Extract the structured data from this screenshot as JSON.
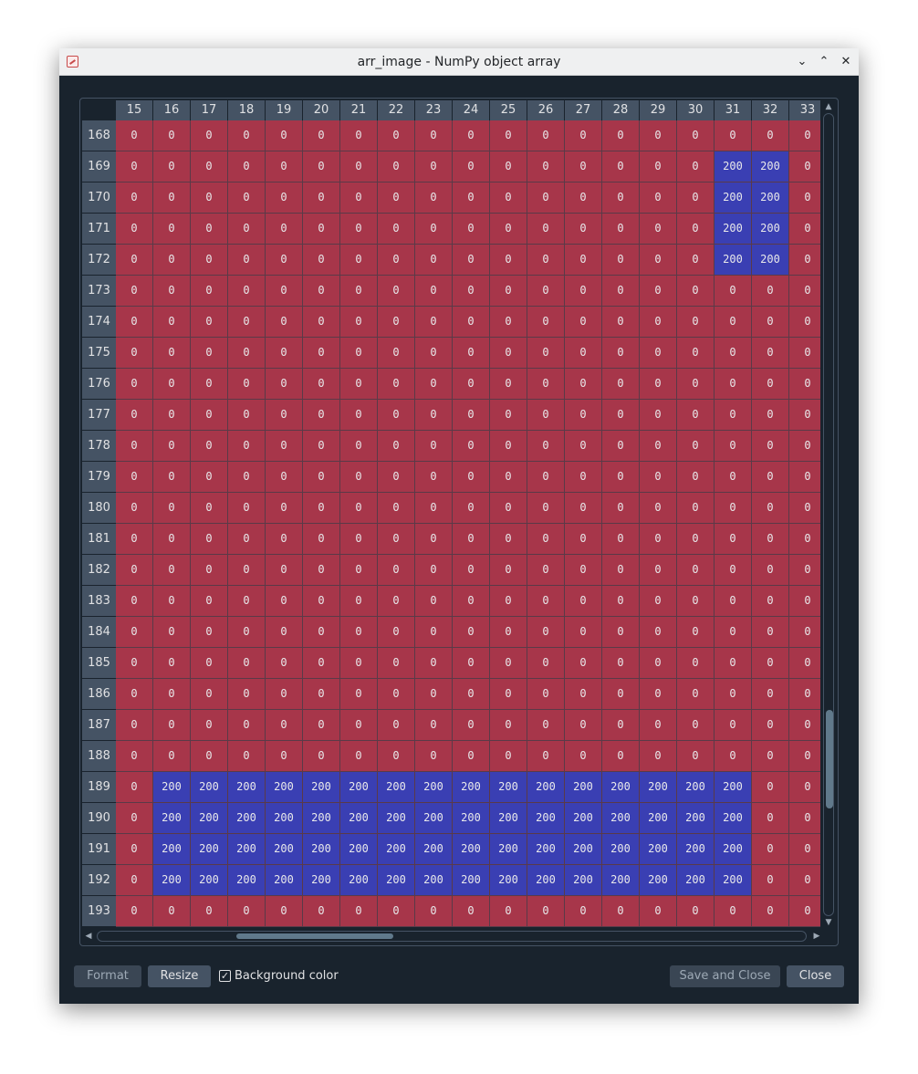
{
  "window": {
    "title": "arr_image - NumPy object array",
    "controls": {
      "minimize": "⌄",
      "maximize": "⌃",
      "close": "✕"
    }
  },
  "table": {
    "columns": [
      15,
      16,
      17,
      18,
      19,
      20,
      21,
      22,
      23,
      24,
      25,
      26,
      27,
      28,
      29,
      30,
      31,
      32,
      33
    ],
    "rows": [
      168,
      169,
      170,
      171,
      172,
      173,
      174,
      175,
      176,
      177,
      178,
      179,
      180,
      181,
      182,
      183,
      184,
      185,
      186,
      187,
      188,
      189,
      190,
      191,
      192,
      193
    ],
    "values": [
      [
        0,
        0,
        0,
        0,
        0,
        0,
        0,
        0,
        0,
        0,
        0,
        0,
        0,
        0,
        0,
        0,
        0,
        0,
        0
      ],
      [
        0,
        0,
        0,
        0,
        0,
        0,
        0,
        0,
        0,
        0,
        0,
        0,
        0,
        0,
        0,
        0,
        200,
        200,
        0
      ],
      [
        0,
        0,
        0,
        0,
        0,
        0,
        0,
        0,
        0,
        0,
        0,
        0,
        0,
        0,
        0,
        0,
        200,
        200,
        0
      ],
      [
        0,
        0,
        0,
        0,
        0,
        0,
        0,
        0,
        0,
        0,
        0,
        0,
        0,
        0,
        0,
        0,
        200,
        200,
        0
      ],
      [
        0,
        0,
        0,
        0,
        0,
        0,
        0,
        0,
        0,
        0,
        0,
        0,
        0,
        0,
        0,
        0,
        200,
        200,
        0
      ],
      [
        0,
        0,
        0,
        0,
        0,
        0,
        0,
        0,
        0,
        0,
        0,
        0,
        0,
        0,
        0,
        0,
        0,
        0,
        0
      ],
      [
        0,
        0,
        0,
        0,
        0,
        0,
        0,
        0,
        0,
        0,
        0,
        0,
        0,
        0,
        0,
        0,
        0,
        0,
        0
      ],
      [
        0,
        0,
        0,
        0,
        0,
        0,
        0,
        0,
        0,
        0,
        0,
        0,
        0,
        0,
        0,
        0,
        0,
        0,
        0
      ],
      [
        0,
        0,
        0,
        0,
        0,
        0,
        0,
        0,
        0,
        0,
        0,
        0,
        0,
        0,
        0,
        0,
        0,
        0,
        0
      ],
      [
        0,
        0,
        0,
        0,
        0,
        0,
        0,
        0,
        0,
        0,
        0,
        0,
        0,
        0,
        0,
        0,
        0,
        0,
        0
      ],
      [
        0,
        0,
        0,
        0,
        0,
        0,
        0,
        0,
        0,
        0,
        0,
        0,
        0,
        0,
        0,
        0,
        0,
        0,
        0
      ],
      [
        0,
        0,
        0,
        0,
        0,
        0,
        0,
        0,
        0,
        0,
        0,
        0,
        0,
        0,
        0,
        0,
        0,
        0,
        0
      ],
      [
        0,
        0,
        0,
        0,
        0,
        0,
        0,
        0,
        0,
        0,
        0,
        0,
        0,
        0,
        0,
        0,
        0,
        0,
        0
      ],
      [
        0,
        0,
        0,
        0,
        0,
        0,
        0,
        0,
        0,
        0,
        0,
        0,
        0,
        0,
        0,
        0,
        0,
        0,
        0
      ],
      [
        0,
        0,
        0,
        0,
        0,
        0,
        0,
        0,
        0,
        0,
        0,
        0,
        0,
        0,
        0,
        0,
        0,
        0,
        0
      ],
      [
        0,
        0,
        0,
        0,
        0,
        0,
        0,
        0,
        0,
        0,
        0,
        0,
        0,
        0,
        0,
        0,
        0,
        0,
        0
      ],
      [
        0,
        0,
        0,
        0,
        0,
        0,
        0,
        0,
        0,
        0,
        0,
        0,
        0,
        0,
        0,
        0,
        0,
        0,
        0
      ],
      [
        0,
        0,
        0,
        0,
        0,
        0,
        0,
        0,
        0,
        0,
        0,
        0,
        0,
        0,
        0,
        0,
        0,
        0,
        0
      ],
      [
        0,
        0,
        0,
        0,
        0,
        0,
        0,
        0,
        0,
        0,
        0,
        0,
        0,
        0,
        0,
        0,
        0,
        0,
        0
      ],
      [
        0,
        0,
        0,
        0,
        0,
        0,
        0,
        0,
        0,
        0,
        0,
        0,
        0,
        0,
        0,
        0,
        0,
        0,
        0
      ],
      [
        0,
        0,
        0,
        0,
        0,
        0,
        0,
        0,
        0,
        0,
        0,
        0,
        0,
        0,
        0,
        0,
        0,
        0,
        0
      ],
      [
        0,
        200,
        200,
        200,
        200,
        200,
        200,
        200,
        200,
        200,
        200,
        200,
        200,
        200,
        200,
        200,
        200,
        0,
        0
      ],
      [
        0,
        200,
        200,
        200,
        200,
        200,
        200,
        200,
        200,
        200,
        200,
        200,
        200,
        200,
        200,
        200,
        200,
        0,
        0
      ],
      [
        0,
        200,
        200,
        200,
        200,
        200,
        200,
        200,
        200,
        200,
        200,
        200,
        200,
        200,
        200,
        200,
        200,
        0,
        0
      ],
      [
        0,
        200,
        200,
        200,
        200,
        200,
        200,
        200,
        200,
        200,
        200,
        200,
        200,
        200,
        200,
        200,
        200,
        0,
        0
      ],
      [
        0,
        0,
        0,
        0,
        0,
        0,
        0,
        0,
        0,
        0,
        0,
        0,
        0,
        0,
        0,
        0,
        0,
        0,
        0
      ]
    ],
    "colors": {
      "low": "#a7364a",
      "high": "#3a3fb3"
    },
    "vertical_scroll_fraction": 0.85,
    "horizontal_scroll_fraction": 0.25
  },
  "footer": {
    "format_label": "Format",
    "resize_label": "Resize",
    "background_color_label": "Background color",
    "background_color_checked": true,
    "save_close_label": "Save and Close",
    "close_label": "Close"
  }
}
